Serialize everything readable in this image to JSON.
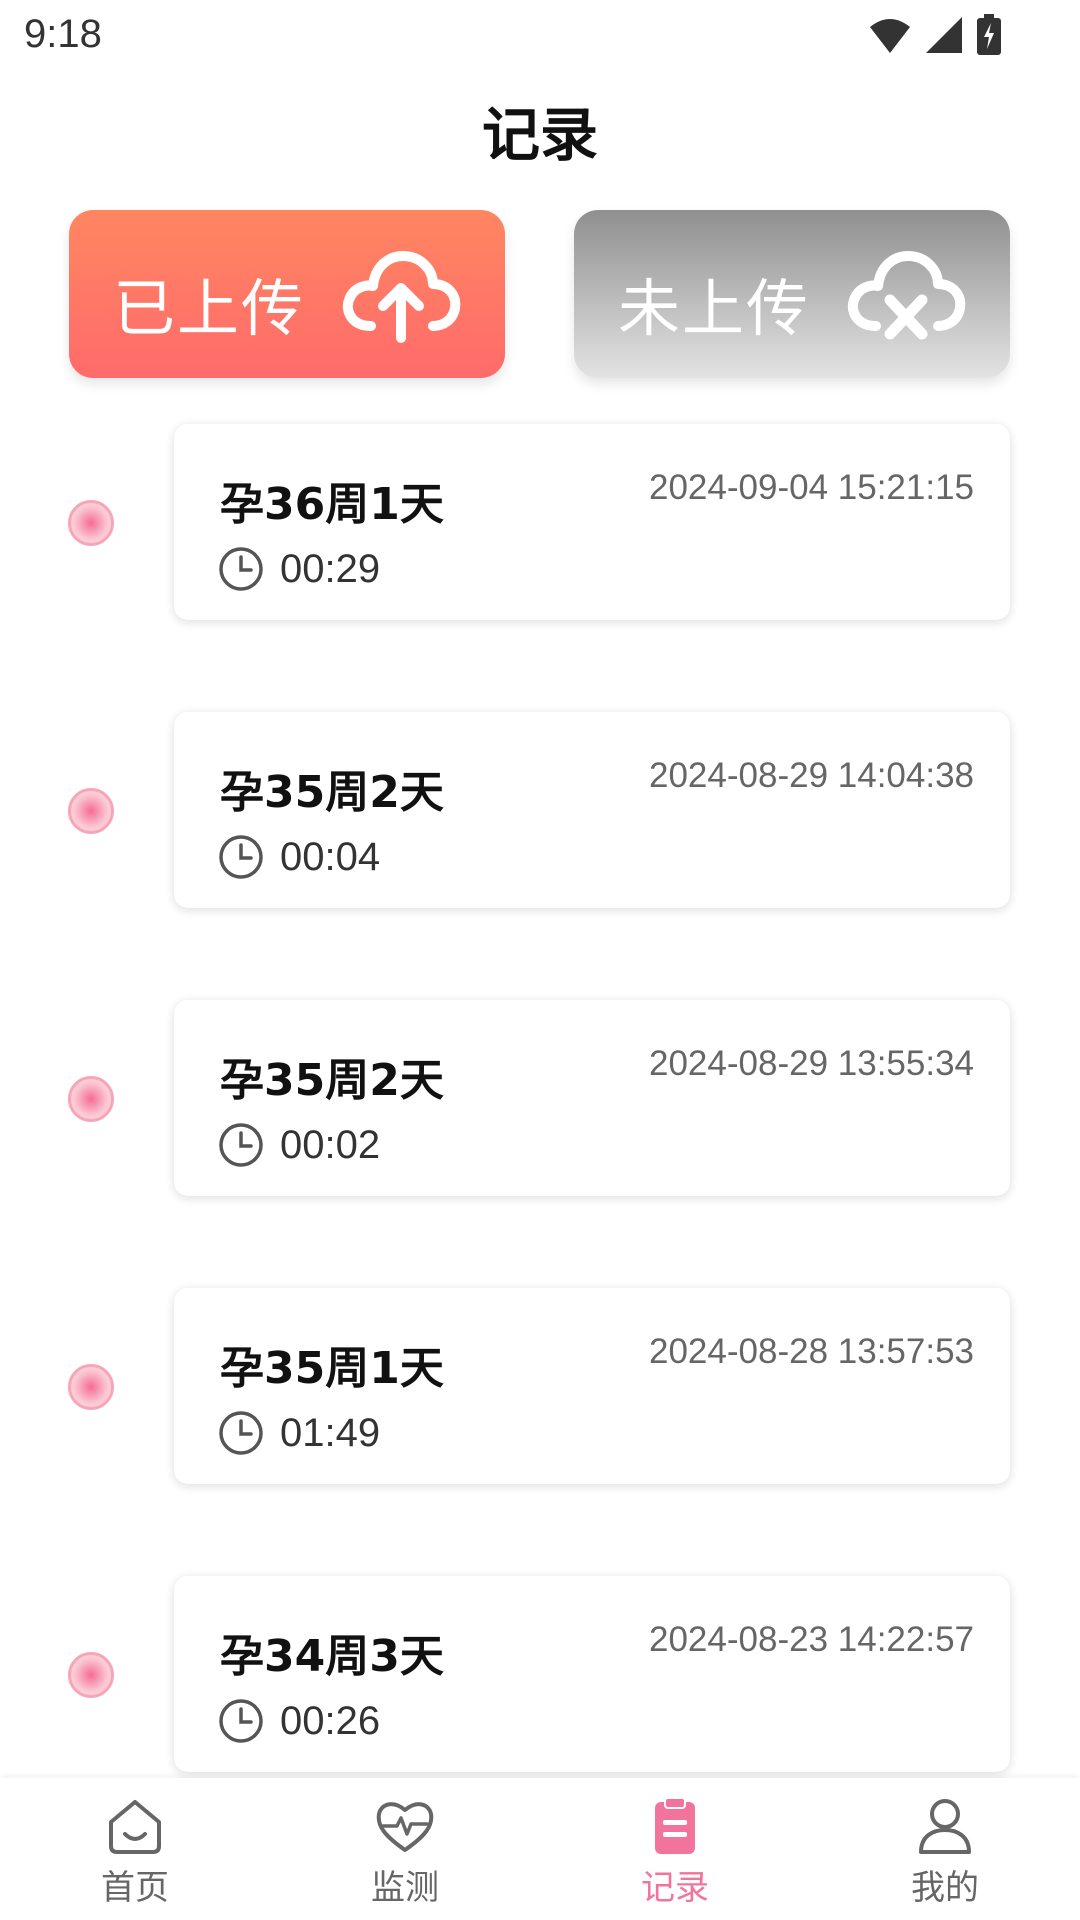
{
  "status_bar": {
    "time": "9:18"
  },
  "header": {
    "title": "记录"
  },
  "filter": {
    "uploaded_label": "已上传",
    "not_uploaded_label": "未上传",
    "icons": [
      "cloud-upload-icon",
      "cloud-x-icon"
    ]
  },
  "records": [
    {
      "week": "孕36周1天",
      "datetime": "2024-09-04 15:21:15",
      "duration": "00:29"
    },
    {
      "week": "孕35周2天",
      "datetime": "2024-08-29 14:04:38",
      "duration": "00:04"
    },
    {
      "week": "孕35周2天",
      "datetime": "2024-08-29 13:55:34",
      "duration": "00:02"
    },
    {
      "week": "孕35周1天",
      "datetime": "2024-08-28 13:57:53",
      "duration": "01:49"
    },
    {
      "week": "孕34周3天",
      "datetime": "2024-08-23 14:22:57",
      "duration": "00:26"
    }
  ],
  "bottom_nav": {
    "items": [
      {
        "label": "首页",
        "icon": "home-icon"
      },
      {
        "label": "监测",
        "icon": "heart-monitor-icon"
      },
      {
        "label": "记录",
        "icon": "clipboard-icon",
        "active": true
      },
      {
        "label": "我的",
        "icon": "person-icon"
      }
    ]
  },
  "colors": {
    "accent_pink": "#f2739b",
    "uploaded_gradient_top": "#ff8661",
    "uploaded_gradient_bottom": "#ff6b6b",
    "not_uploaded_gray": "#8f8f8f"
  }
}
